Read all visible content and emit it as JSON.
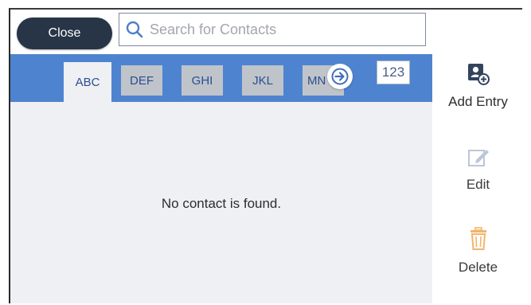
{
  "header": {
    "close_label": "Close",
    "search_placeholder": "Search for Contacts"
  },
  "tabs": [
    {
      "label": "ABC",
      "active": true
    },
    {
      "label": "DEF",
      "active": false
    },
    {
      "label": "GHI",
      "active": false
    },
    {
      "label": "JKL",
      "active": false
    },
    {
      "label": "MN",
      "active": false
    },
    {
      "label": "123",
      "active": false
    }
  ],
  "list": {
    "empty_message": "No contact is found."
  },
  "actions": {
    "add_entry": "Add Entry",
    "edit": "Edit",
    "delete": "Delete"
  },
  "icons": {
    "search": "search-icon",
    "next": "arrow-right-icon",
    "add": "add-contact-icon",
    "edit": "edit-icon",
    "delete": "trash-icon"
  },
  "colors": {
    "close_button": "#273547",
    "tab_strip": "#4e84cf",
    "list_bg": "#eef0f3",
    "disabled_icon": "#bcc6d8",
    "delete_icon": "#f2b56b"
  }
}
